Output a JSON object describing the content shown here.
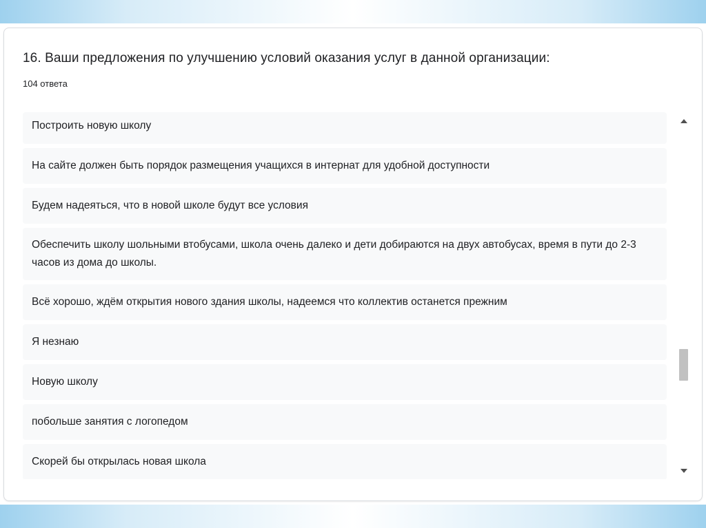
{
  "question": {
    "title": "16. Ваши предложения по улучшению условий оказания услуг в данной организации:",
    "response_count": "104 ответа"
  },
  "answers": [
    {
      "text": "Построить новую школу"
    },
    {
      "text": "На сайте должен быть порядок размещения учащихся в интернат для удобной доступности"
    },
    {
      "text": "Будем надеяться, что в новой школе будут все условия"
    },
    {
      "text": "Обеспечить школу шольными втобусами, школа очень далеко и дети добираются на двух автобусах, время в пути до 2-3 часов из дома до школы."
    },
    {
      "text": "Всё хорошо, ждём открытия нового здания школы, надеемся что коллектив останется прежним"
    },
    {
      "text": "Я незнаю"
    },
    {
      "text": "Новую школу"
    },
    {
      "text": "побольше занятия с логопедом"
    },
    {
      "text": "Скорей бы открылась новая школа"
    }
  ],
  "scrollbar": {
    "up_icon": "triangle-up-icon",
    "down_icon": "triangle-down-icon",
    "position_fraction": 0.68
  },
  "colors": {
    "answer_background": "#f8f9fa",
    "card_border": "#dadce0",
    "text": "#202124",
    "frame_accent": "#9ed1ee"
  }
}
